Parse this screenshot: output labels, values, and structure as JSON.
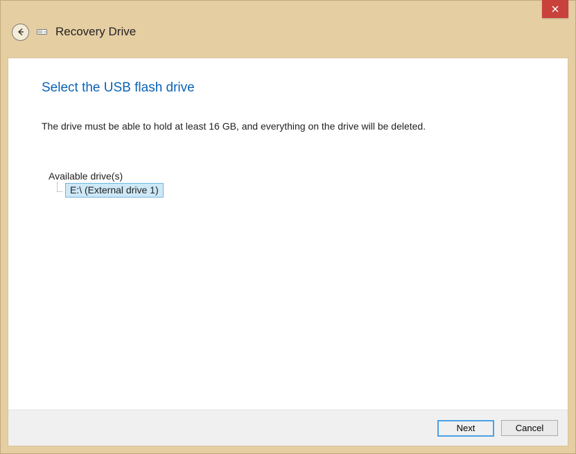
{
  "window": {
    "title": "Recovery Drive"
  },
  "page": {
    "heading": "Select the USB flash drive",
    "body": "The drive must be able to hold at least 16 GB, and everything on the drive will be deleted.",
    "available_label": "Available drive(s)",
    "drives": [
      {
        "label": "E:\\ (External drive 1)"
      }
    ]
  },
  "buttons": {
    "next": "Next",
    "cancel": "Cancel"
  }
}
